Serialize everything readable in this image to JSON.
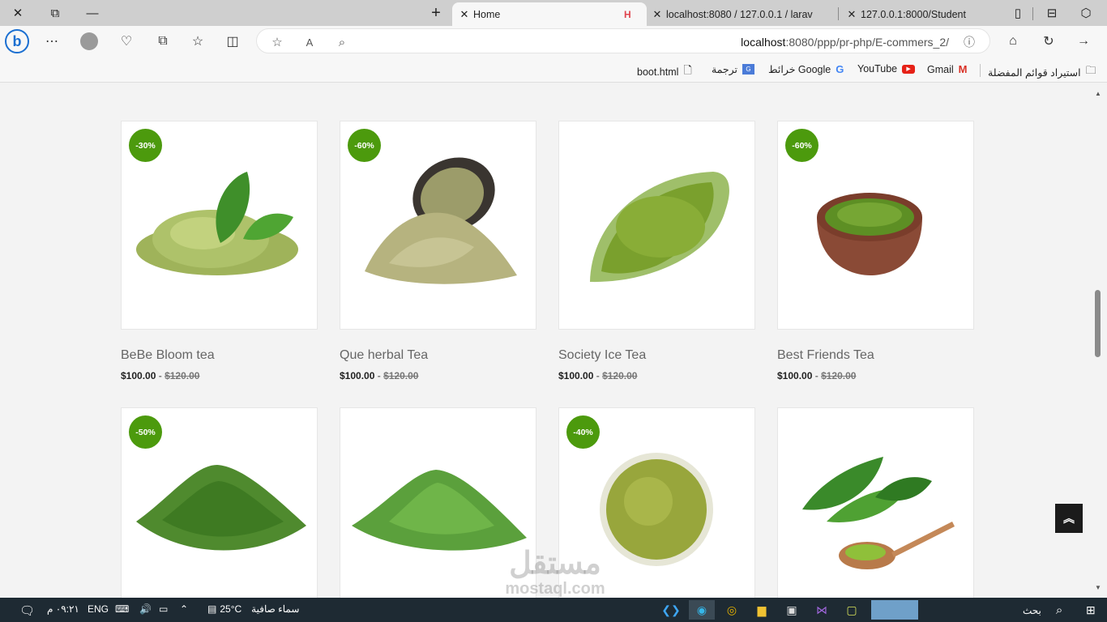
{
  "browser": {
    "tabs": [
      {
        "title": "Home",
        "active": true
      },
      {
        "title": "localhost:8080 / 127.0.0.1 / larav"
      },
      {
        "title": "127.0.0.1:8000/Student"
      }
    ],
    "address": {
      "host": "localhost",
      "rest": ":8080/ppp/pr-php/E-commers_2/"
    },
    "bookmarks": [
      {
        "label": "استيراد قوائم المفضلة",
        "icon": "folder-import-icon"
      },
      {
        "label": "Gmail",
        "icon": "gmail-icon"
      },
      {
        "label": "YouTube",
        "icon": "youtube-icon"
      },
      {
        "label": "خرائط Google",
        "icon": "google-icon"
      },
      {
        "label": "ترجمة",
        "icon": "translate-icon"
      },
      {
        "label": "boot.html",
        "icon": "file-icon"
      }
    ]
  },
  "products": [
    {
      "name": "BeBe Bloom tea",
      "price": "$100.00",
      "old_price": "$120.00",
      "badge": "-30%"
    },
    {
      "name": "Que herbal Tea",
      "price": "$100.00",
      "old_price": "$120.00",
      "badge": "-60%"
    },
    {
      "name": "Society Ice Tea",
      "price": "$100.00",
      "old_price": "$120.00",
      "badge": ""
    },
    {
      "name": "Best Friends Tea",
      "price": "$100.00",
      "old_price": "$120.00",
      "badge": "-60%"
    },
    {
      "name": "",
      "price": "",
      "old_price": "",
      "badge": "-50%"
    },
    {
      "name": "",
      "price": "",
      "old_price": "",
      "badge": ""
    },
    {
      "name": "",
      "price": "",
      "old_price": "",
      "badge": "-40%"
    },
    {
      "name": "",
      "price": "",
      "old_price": "",
      "badge": ""
    }
  ],
  "price_separator": "-",
  "watermark": {
    "arabic": "مستقل",
    "latin": "mostaql.com"
  },
  "taskbar": {
    "time": "٠٩:٢١ م",
    "lang": "ENG",
    "temperature": "25°C",
    "weather": "سماء صافية",
    "search": "بحث"
  }
}
